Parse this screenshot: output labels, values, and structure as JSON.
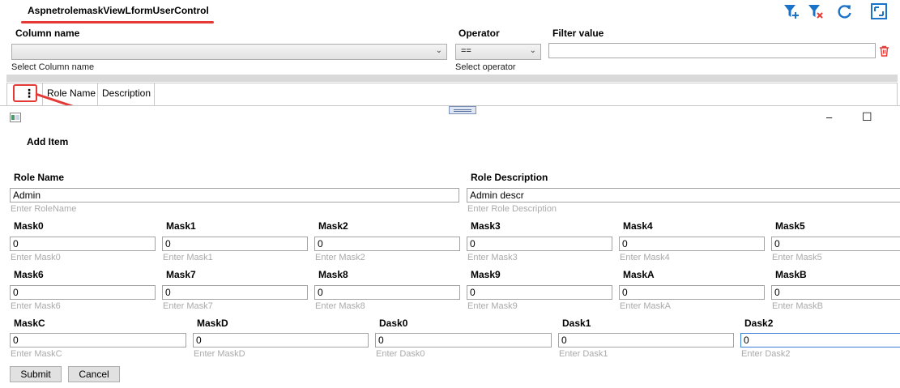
{
  "window_title": "AspnetrolemaskViewLformUserControl",
  "colors": {
    "accent": "#1a73c8",
    "danger": "#e53935"
  },
  "filter": {
    "column_label": "Column name",
    "column_value": "",
    "column_hint": "Select Column name",
    "operator_label": "Operator",
    "operator_value": "==",
    "operator_hint": "Select operator",
    "value_label": "Filter value",
    "value_text": ""
  },
  "toolbar": {
    "icons": [
      "add-filter-icon",
      "clear-filter-icon",
      "refresh-icon",
      "maximize-icon"
    ]
  },
  "grid": {
    "columns": [
      "Role Name",
      "Description"
    ],
    "menu_glyph": "⋮"
  },
  "dialog": {
    "title": "Add Item",
    "minimize": "–",
    "maximize": "☐",
    "role_name": {
      "label": "Role Name",
      "value": "Admin",
      "placeholder": "Enter RoleName"
    },
    "role_description": {
      "label": "Role Description",
      "value": "Admin descr",
      "placeholder": "Enter Role Description"
    },
    "row1": [
      {
        "label": "Mask0",
        "value": "0",
        "placeholder": "Enter Mask0"
      },
      {
        "label": "Mask1",
        "value": "0",
        "placeholder": "Enter Mask1"
      },
      {
        "label": "Mask2",
        "value": "0",
        "placeholder": "Enter Mask2"
      },
      {
        "label": "Mask3",
        "value": "0",
        "placeholder": "Enter Mask3"
      },
      {
        "label": "Mask4",
        "value": "0",
        "placeholder": "Enter Mask4"
      },
      {
        "label": "Mask5",
        "value": "0",
        "placeholder": "Enter Mask5"
      }
    ],
    "row2": [
      {
        "label": "Mask6",
        "value": "0",
        "placeholder": "Enter Mask6"
      },
      {
        "label": "Mask7",
        "value": "0",
        "placeholder": "Enter Mask7"
      },
      {
        "label": "Mask8",
        "value": "0",
        "placeholder": "Enter Mask8"
      },
      {
        "label": "Mask9",
        "value": "0",
        "placeholder": "Enter Mask9"
      },
      {
        "label": "MaskA",
        "value": "0",
        "placeholder": "Enter MaskA"
      },
      {
        "label": "MaskB",
        "value": "0",
        "placeholder": "Enter MaskB"
      }
    ],
    "row3": [
      {
        "label": "MaskC",
        "value": "0",
        "placeholder": "Enter MaskC"
      },
      {
        "label": "MaskD",
        "value": "0",
        "placeholder": "Enter MaskD"
      },
      {
        "label": "Dask0",
        "value": "0",
        "placeholder": "Enter Dask0"
      },
      {
        "label": "Dask1",
        "value": "0",
        "placeholder": "Enter Dask1"
      },
      {
        "label": "Dask2",
        "value": "0",
        "placeholder": "Enter Dask2"
      }
    ],
    "submit_label": "Submit",
    "cancel_label": "Cancel"
  }
}
